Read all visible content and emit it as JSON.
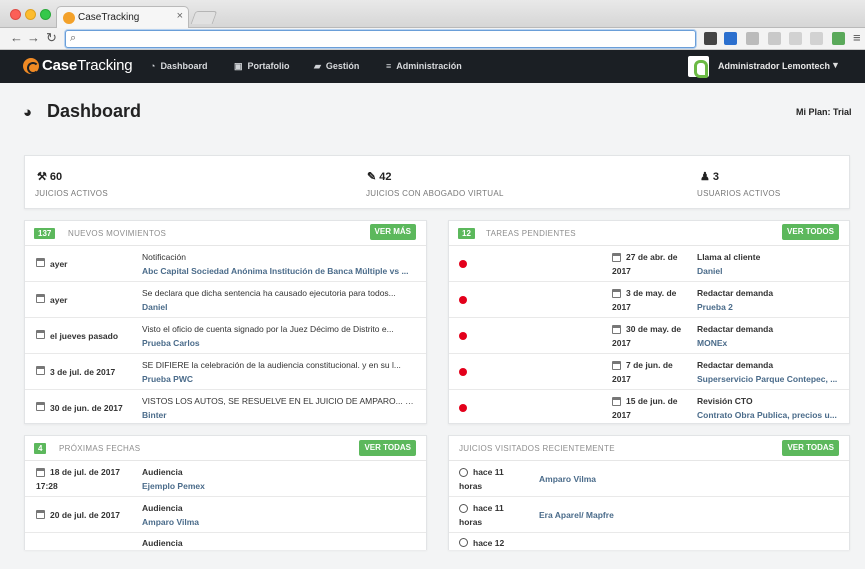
{
  "browser": {
    "tab_title": "CaseTracking",
    "tab_close": "×",
    "url_placeholder": ""
  },
  "app": {
    "logo_bold": "Case",
    "logo_rest": "Tracking",
    "menu": [
      {
        "label": "Dashboard",
        "icon": "dashboard-icon"
      },
      {
        "label": "Portafolio",
        "icon": "briefcase-icon"
      },
      {
        "label": "Gestión",
        "icon": "folder-icon"
      },
      {
        "label": "Administración",
        "icon": "menu-icon"
      }
    ],
    "user": "Administrador Lemontech"
  },
  "page": {
    "title": "Dashboard",
    "plan": "Mi Plan: Trial"
  },
  "stats": [
    {
      "value": "60",
      "label": "JUICIOS ACTIVOS",
      "icon": "gavel-icon"
    },
    {
      "value": "42",
      "label": "JUICIOS CON ABOGADO VIRTUAL",
      "icon": "magic-wand-icon"
    },
    {
      "value": "3",
      "label": "USUARIOS ACTIVOS",
      "icon": "user-icon"
    }
  ],
  "movimientos": {
    "count": "137",
    "title": "NUEVOS MOVIMIENTOS",
    "button": "VER MÁS",
    "rows": [
      {
        "date": "ayer",
        "title": "Notificación",
        "sub": "Abc Capital Sociedad Anónima Institución de Banca Múltiple vs ..."
      },
      {
        "date": "ayer",
        "title": "Se declara que dicha sentencia ha causado ejecutoria para todos...",
        "sub": "Daniel"
      },
      {
        "date": "el jueves pasado",
        "title": "Visto el oficio de cuenta signado por la Juez Décimo de Distrito e...",
        "sub": "Prueba Carlos"
      },
      {
        "date": "3 de jul. de 2017",
        "title": "SE DIFIERE la celebración de la audiencia constitucional. y en su l...",
        "sub": "Prueba PWC"
      },
      {
        "date": "30 de jun. de 2017",
        "title": "VISTOS LOS AUTOS, SE RESUELVE EN EL JUICIO DE AMPARO... SE, R...",
        "sub": "Binter"
      }
    ]
  },
  "tareas": {
    "count": "12",
    "title": "TAREAS PENDIENTES",
    "button": "VER TODOS",
    "rows": [
      {
        "date1": "27 de abr. de",
        "date2": "2017",
        "title": "Llama al cliente",
        "sub": "Daniel"
      },
      {
        "date1": "3 de may. de",
        "date2": "2017",
        "title": "Redactar demanda",
        "sub": "Prueba 2"
      },
      {
        "date1": "30 de may. de",
        "date2": "2017",
        "title": "Redactar demanda",
        "sub": "MONEx"
      },
      {
        "date1": "7 de jun. de",
        "date2": "2017",
        "title": "Redactar demanda",
        "sub": "Superservicio Parque Contepec, ..."
      },
      {
        "date1": "15 de jun. de",
        "date2": "2017",
        "title": "Revisión CTO",
        "sub": "Contrato Obra Publica, precios u..."
      }
    ]
  },
  "fechas": {
    "count": "4",
    "title": "PRÓXIMAS FECHAS",
    "button": "VER TODAS",
    "rows": [
      {
        "date1": "18 de jul. de 2017",
        "date2": "17:28",
        "title": "Audiencia",
        "sub": "Ejemplo Pemex"
      },
      {
        "date1": "20 de jul. de 2017",
        "date2": "",
        "title": "Audiencia",
        "sub": "Amparo Vilma"
      },
      {
        "date1": "",
        "date2": "",
        "title": "Audiencia",
        "sub": ""
      }
    ]
  },
  "visitados": {
    "title": "JUICIOS VISITADOS RECIENTEMENTE",
    "button": "VER TODAS",
    "rows": [
      {
        "when1": "hace 11",
        "when2": "horas",
        "name": "Amparo Vilma"
      },
      {
        "when1": "hace 11",
        "when2": "horas",
        "name": "Era Aparel/ Mapfre"
      },
      {
        "when1": "hace 12",
        "when2": "",
        "name": ""
      }
    ]
  }
}
